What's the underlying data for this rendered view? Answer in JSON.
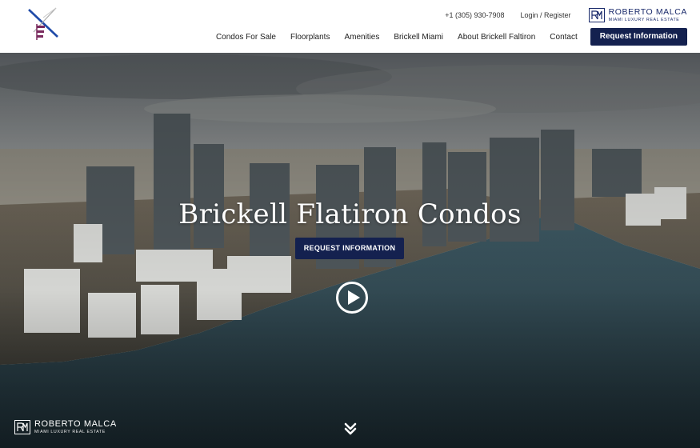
{
  "header": {
    "phone": "+1 (305) 930-7908",
    "login": "Login / Register",
    "brand": {
      "name": "ROBERTO MALCA",
      "tagline": "MIAMI LUXURY REAL ESTATE"
    }
  },
  "nav": {
    "items": [
      {
        "label": "Condos For Sale"
      },
      {
        "label": "Floorplants"
      },
      {
        "label": "Amenities"
      },
      {
        "label": "Brickell Miami"
      },
      {
        "label": "About Brickell Faltiron"
      },
      {
        "label": "Contact"
      }
    ],
    "cta": "Request Information"
  },
  "hero": {
    "title": "Brickell Flatiron Condos",
    "button": "REQUEST INFORMATION",
    "footer_brand": {
      "name": "ROBERTO MALCA",
      "tagline": "MIAMI LUXURY REAL ESTATE"
    }
  },
  "icons": {
    "logo": "flatiron-logo-icon",
    "brand_mark": "rm-monogram-icon",
    "play": "play-icon",
    "scroll": "double-chevron-down-icon"
  },
  "colors": {
    "navy": "#14214f",
    "brand_blue": "#1a2a6b"
  }
}
